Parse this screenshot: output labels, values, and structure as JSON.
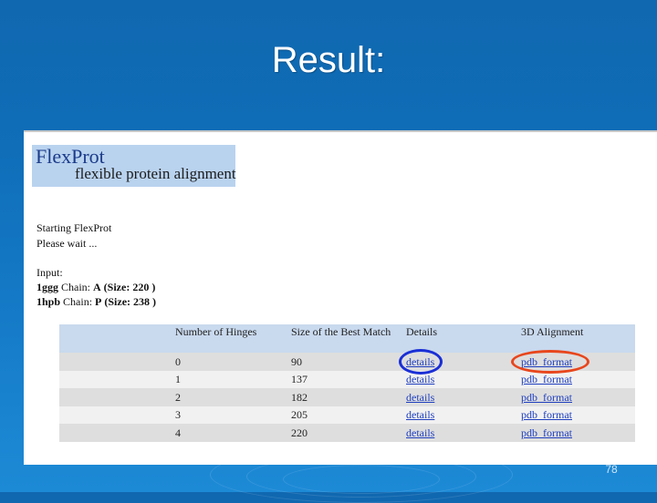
{
  "slide": {
    "title": "Result:",
    "page_number": "78"
  },
  "app": {
    "logo_title": "FlexProt",
    "logo_subtitle": "flexible protein alignment",
    "status_lines": [
      "Starting FlexProt",
      "Please wait ..."
    ],
    "input_label": "Input:",
    "inputs": [
      {
        "id": "1ggg",
        "chain_label": "Chain:",
        "chain": "A",
        "size_text": "(Size: 220 )"
      },
      {
        "id": "1hpb",
        "chain_label": "Chain:",
        "chain": "P",
        "size_text": "(Size: 238 )"
      }
    ]
  },
  "table": {
    "headers": [
      "Number of Hinges",
      "Size of the Best Match",
      "Details",
      "3D Alignment"
    ],
    "rows": [
      {
        "hinges": "0",
        "size": "90",
        "details": "details",
        "alignment": "pdb_format"
      },
      {
        "hinges": "1",
        "size": "137",
        "details": "details",
        "alignment": "pdb_format"
      },
      {
        "hinges": "2",
        "size": "182",
        "details": "details",
        "alignment": "pdb_format"
      },
      {
        "hinges": "3",
        "size": "205",
        "details": "details",
        "alignment": "pdb_format"
      },
      {
        "hinges": "4",
        "size": "220",
        "details": "details",
        "alignment": "pdb_format"
      }
    ]
  },
  "colors": {
    "slide_background": "#1479c6",
    "logo_background": "#b9d3ef",
    "table_header": "#c9d9ee",
    "link": "#1f3fbf",
    "highlight_blue": "#1a2fd6",
    "highlight_red": "#e8461c"
  }
}
